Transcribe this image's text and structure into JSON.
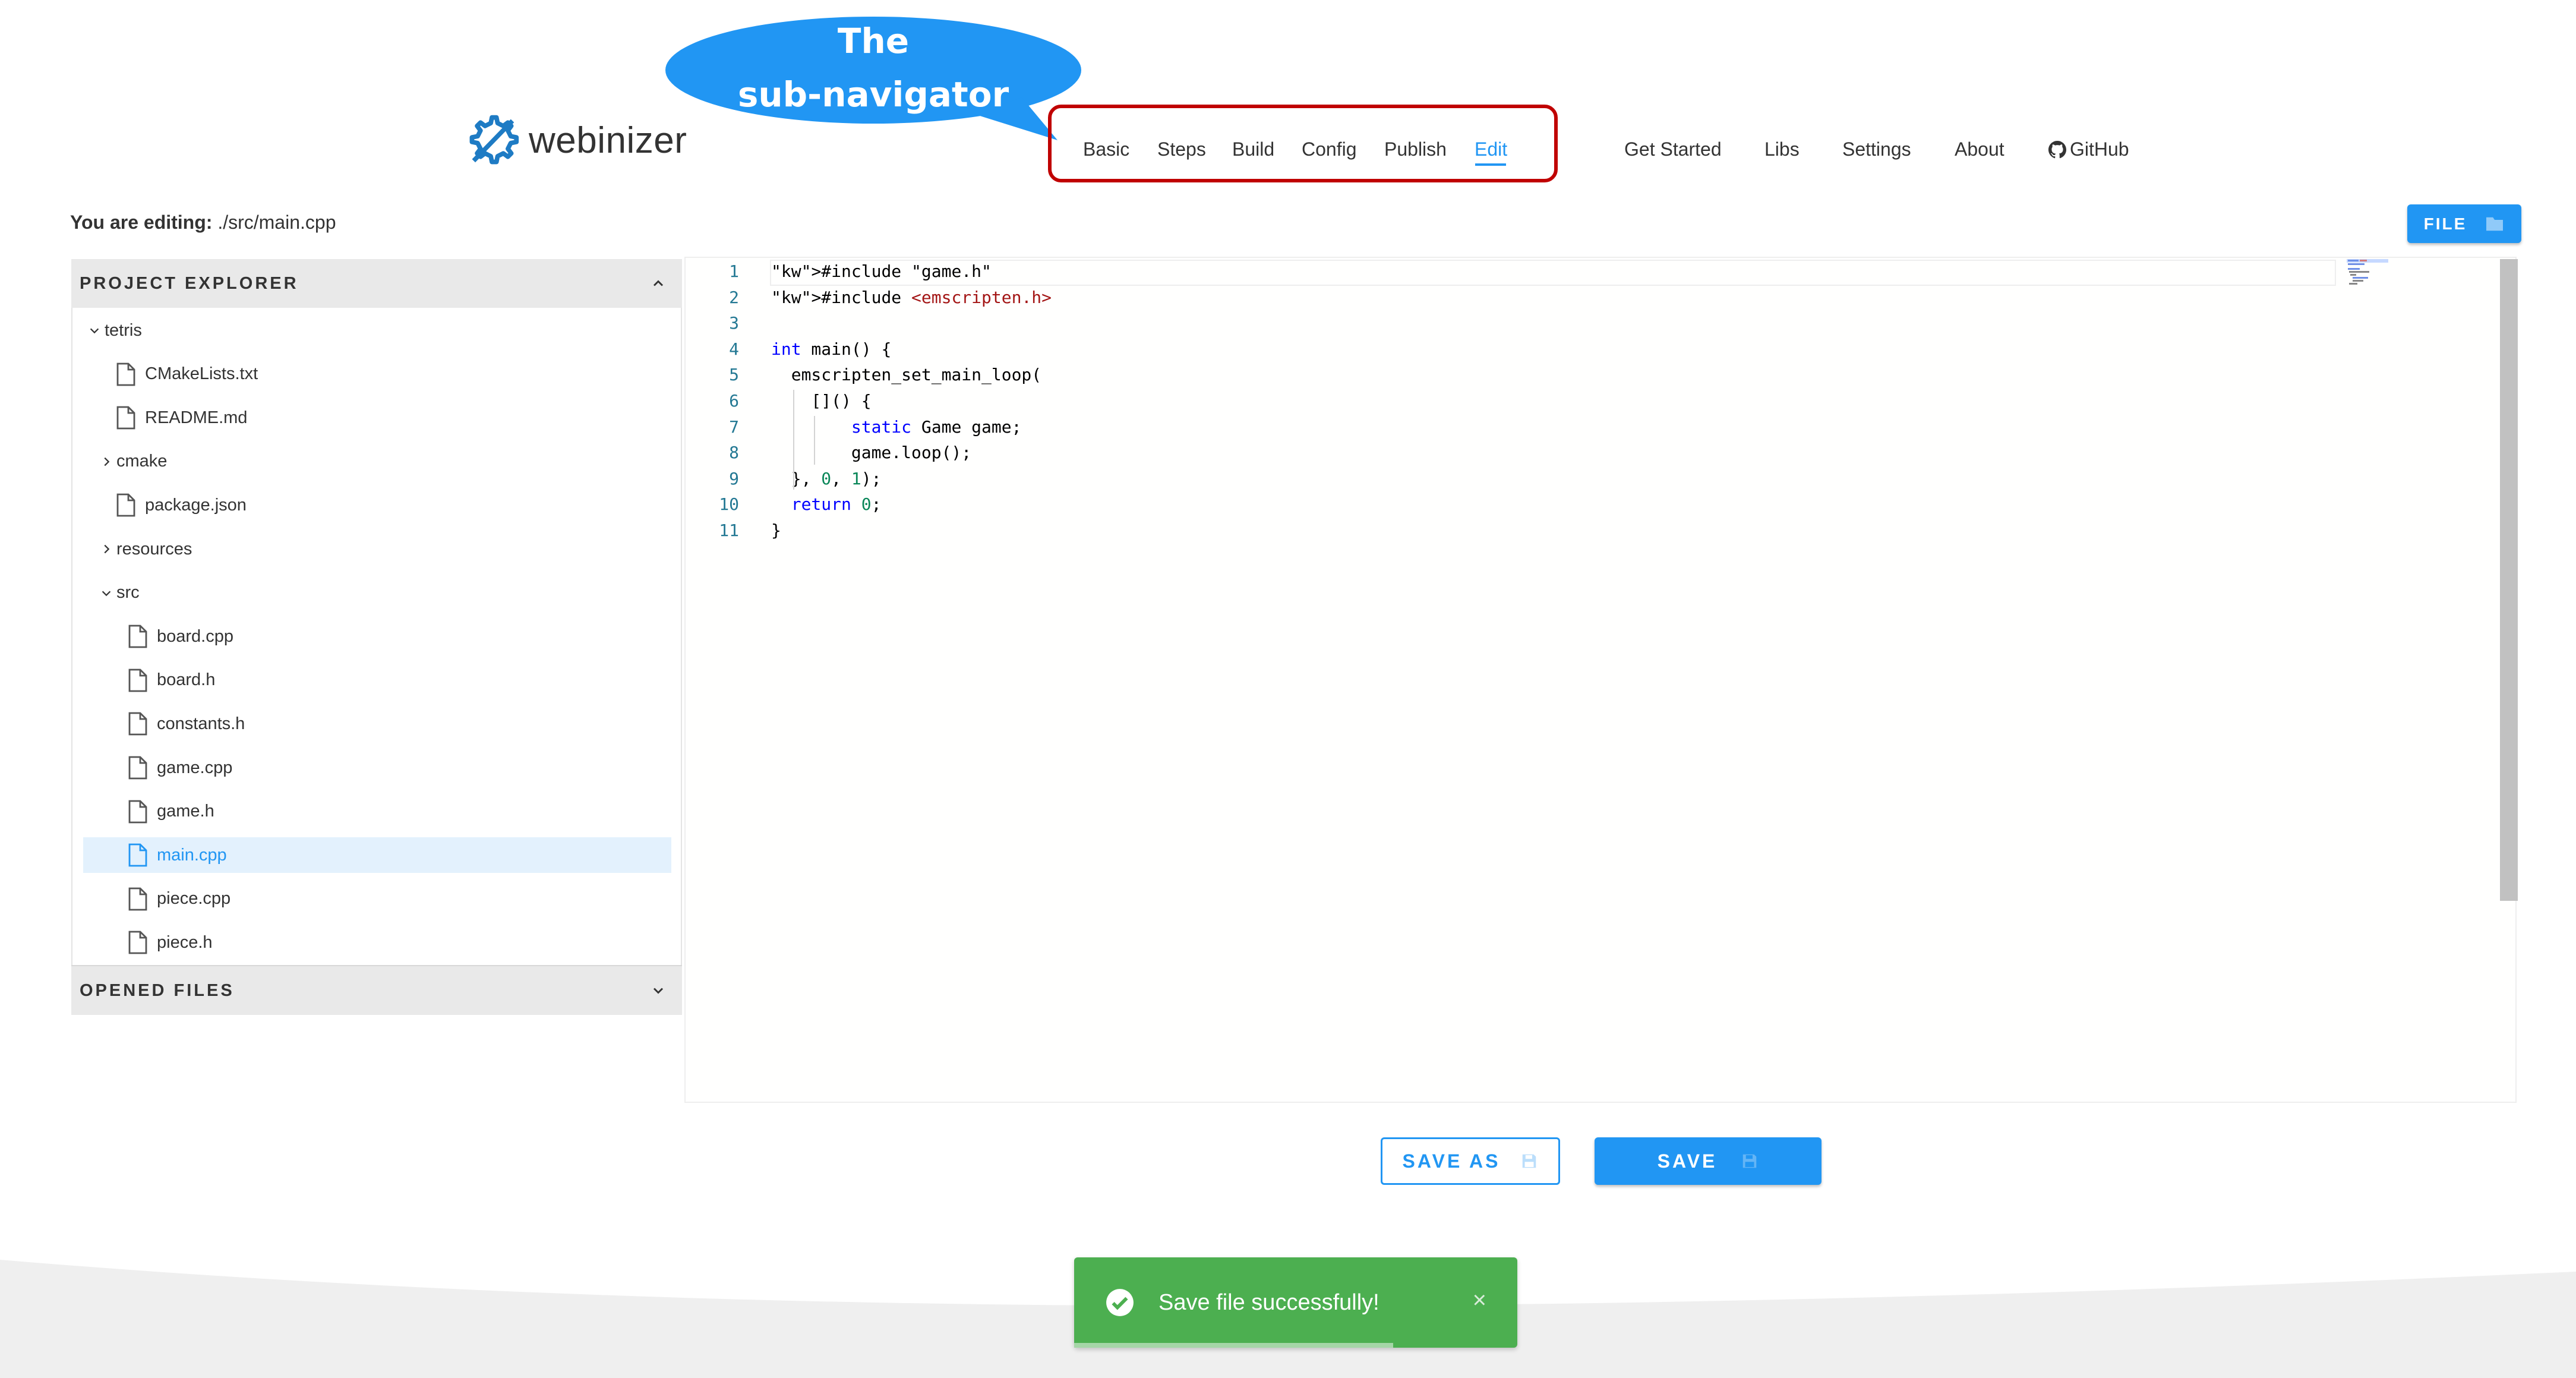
{
  "annotation": {
    "callout_line1": "The",
    "callout_line2": "sub-navigator",
    "colors": {
      "callout": "#2196f3",
      "highlight_box": "#c00000"
    }
  },
  "brand": {
    "name": "webinizer",
    "icon": "gear-slash-logo-icon"
  },
  "subnav": {
    "items": [
      "Basic",
      "Steps",
      "Build",
      "Config",
      "Publish",
      "Edit"
    ],
    "active": "Edit"
  },
  "mainnav": {
    "items": [
      "Get Started",
      "Libs",
      "Settings",
      "About"
    ],
    "github": "GitHub"
  },
  "editing": {
    "label": "You are editing:",
    "path": "./src/main.cpp"
  },
  "file_button": {
    "label": "FILE",
    "icon": "folder-icon"
  },
  "explorer": {
    "title": "PROJECT EXPLORER",
    "tree": [
      {
        "name": "tetris",
        "kind": "folder",
        "expanded": true
      },
      {
        "name": "CMakeLists.txt",
        "kind": "file"
      },
      {
        "name": "README.md",
        "kind": "file"
      },
      {
        "name": "cmake",
        "kind": "folder",
        "expanded": false
      },
      {
        "name": "package.json",
        "kind": "file"
      },
      {
        "name": "resources",
        "kind": "folder",
        "expanded": false
      },
      {
        "name": "src",
        "kind": "folder",
        "expanded": true
      },
      {
        "name": "board.cpp",
        "kind": "file"
      },
      {
        "name": "board.h",
        "kind": "file"
      },
      {
        "name": "constants.h",
        "kind": "file"
      },
      {
        "name": "game.cpp",
        "kind": "file"
      },
      {
        "name": "game.h",
        "kind": "file"
      },
      {
        "name": "main.cpp",
        "kind": "file",
        "selected": true
      },
      {
        "name": "piece.cpp",
        "kind": "file"
      },
      {
        "name": "piece.h",
        "kind": "file"
      }
    ]
  },
  "opened_files": {
    "title": "OPENED FILES"
  },
  "editor": {
    "line_numbers": [
      "1",
      "2",
      "3",
      "4",
      "5",
      "6",
      "7",
      "8",
      "9",
      "10",
      "11"
    ],
    "lines": [
      "#include \"game.h\"",
      "#include <emscripten.h>",
      "",
      "int main() {",
      "  emscripten_set_main_loop(",
      "    []() {",
      "        static Game game;",
      "        game.loop();",
      "  }, 0, 1);",
      "  return 0;",
      "}"
    ]
  },
  "actions": {
    "save_as": "SAVE AS",
    "save": "SAVE",
    "save_icon": "floppy-disk-icon"
  },
  "toast": {
    "message": "Save file successfully!",
    "icon": "check-circle-icon",
    "close": "×",
    "color": "#4caf50",
    "progress_remaining": 0.72
  }
}
